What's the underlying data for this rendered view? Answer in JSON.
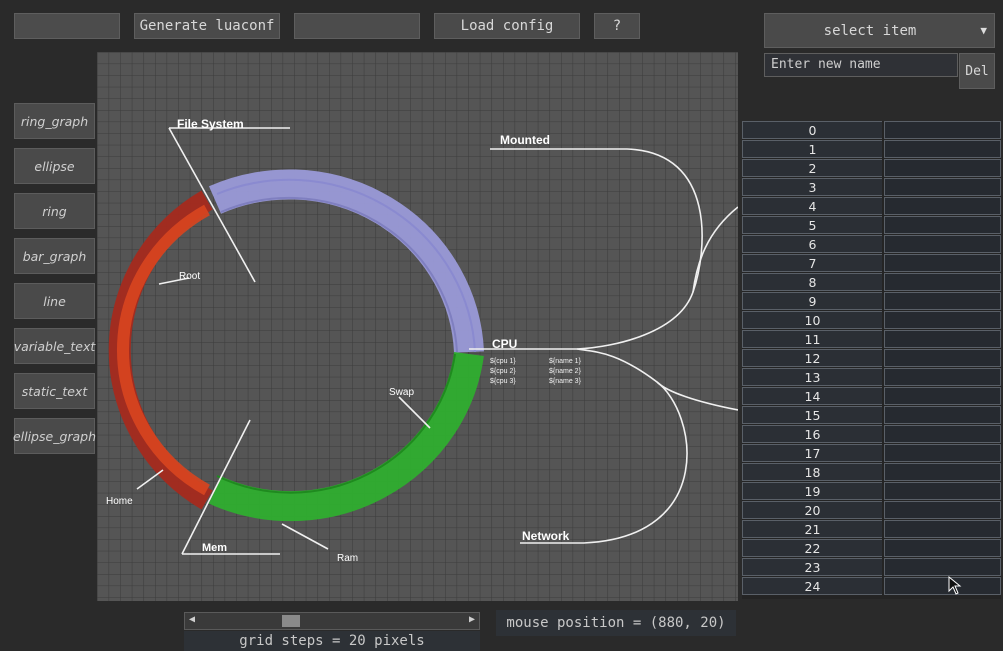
{
  "toolbar": {
    "generate_label": "Generate luaconf",
    "load_label": "Load config",
    "help_label": "?",
    "input1_value": "",
    "input2_value": ""
  },
  "item_select": {
    "selected": "select item",
    "arrow": "▼"
  },
  "name_input": {
    "placeholder": "Enter new name",
    "value": ""
  },
  "delete_label": "Del",
  "sidebar": {
    "items": [
      {
        "label": "ring_graph"
      },
      {
        "label": "ellipse"
      },
      {
        "label": "ring"
      },
      {
        "label": "bar_graph"
      },
      {
        "label": "line"
      },
      {
        "label": "variable_text"
      },
      {
        "label": "static_text"
      },
      {
        "label": "ellipse_graph"
      }
    ]
  },
  "canvas": {
    "labels": {
      "file_system": "File System",
      "mounted": "Mounted",
      "root": "Root",
      "cpu": "CPU",
      "swap": "Swap",
      "home": "Home",
      "mem": "Mem",
      "ram": "Ram",
      "network": "Network"
    },
    "cpu_lines": [
      "${cpu 1}",
      "${cpu 2}",
      "${cpu 3}"
    ],
    "net_lines": [
      "${name 1}",
      "${name 2}",
      "${name 3}"
    ],
    "colors": {
      "filesystem_arc": "#9a9ad8",
      "root_arc": "#a52a1e",
      "root_inner_arc": "#d8451f",
      "mem_arc": "#2fae2f"
    }
  },
  "table": {
    "rows": [
      "0",
      "1",
      "2",
      "3",
      "4",
      "5",
      "6",
      "7",
      "8",
      "9",
      "10",
      "11",
      "12",
      "13",
      "14",
      "15",
      "16",
      "17",
      "18",
      "19",
      "20",
      "21",
      "22",
      "23",
      "24"
    ]
  },
  "status": {
    "grid_steps": "grid steps = 20 pixels",
    "mouse_position": "mouse position = (880, 20)"
  },
  "scrollbar": {
    "left_arrow": "◀",
    "right_arrow": "▶"
  }
}
